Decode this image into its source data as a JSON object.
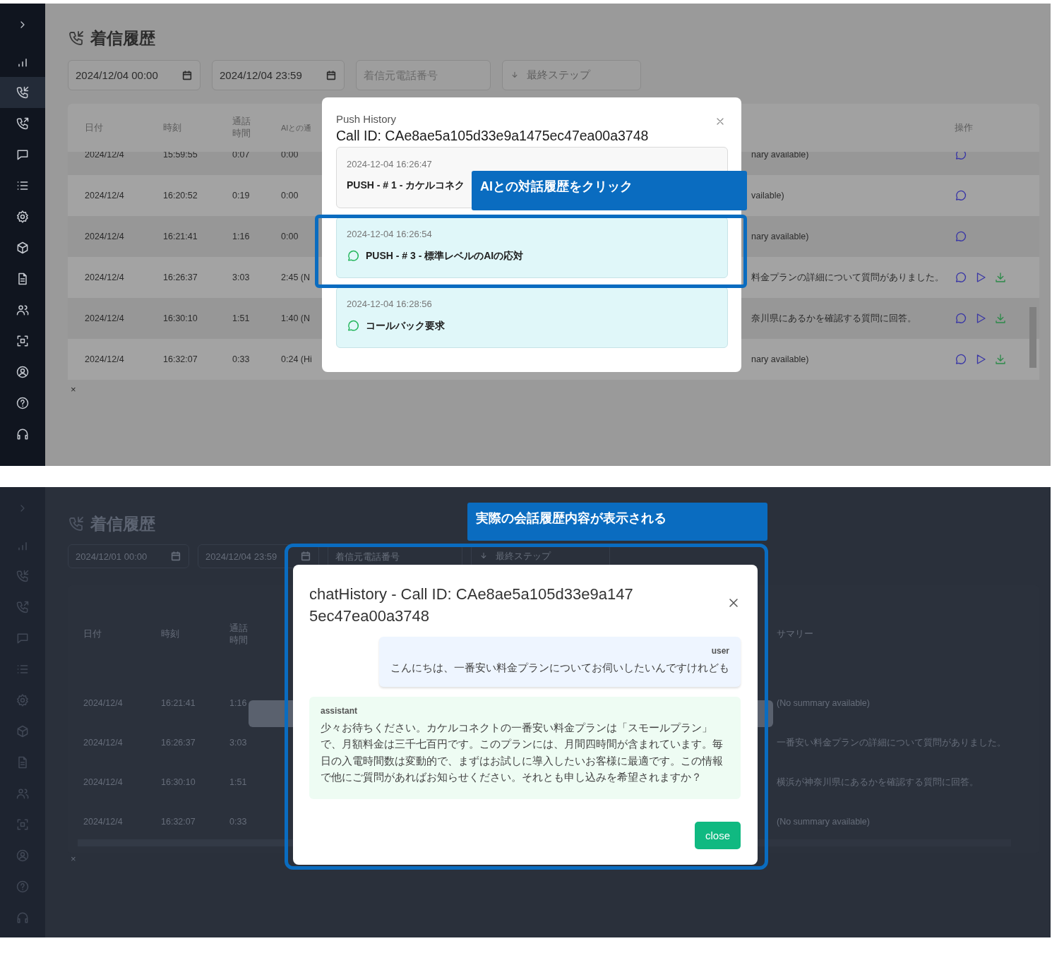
{
  "panels": [
    {
      "kind": "light",
      "sidebar": {
        "items": [
          {
            "selected": false
          },
          {
            "selected": true
          },
          {
            "selected": false
          },
          {
            "selected": false
          },
          {
            "selected": false
          },
          {
            "selected": false
          },
          {
            "selected": false
          },
          {
            "selected": false
          },
          {
            "selected": false
          },
          {
            "selected": false
          },
          {
            "selected": false
          },
          {
            "selected": false
          },
          {
            "selected": false
          }
        ]
      },
      "title": "着信履歴",
      "filters": [
        {
          "kind": "date",
          "value": "2024/12/04 00:00"
        },
        {
          "kind": "date",
          "value": "2024/12/04 23:59"
        },
        {
          "kind": "text",
          "placeholder": "着信元電話番号"
        },
        {
          "kind": "select",
          "label": "最終ステップ"
        }
      ],
      "table": {
        "columns": [
          {
            "kind": "date",
            "label": "日付"
          },
          {
            "kind": "time",
            "label": "時刻"
          },
          {
            "kind": "duration",
            "label": "通話時間"
          },
          {
            "kind": "ai",
            "label": "AIとの通"
          },
          {
            "kind": "actions",
            "label": "操作"
          }
        ],
        "rows": [
          {
            "cells": [
              {
                "kind": "date",
                "text": "2024/12/4"
              },
              {
                "kind": "time",
                "text": "15:59:55"
              },
              {
                "kind": "duration",
                "text": "0:07"
              },
              {
                "kind": "ai",
                "text": "0:00"
              },
              {
                "kind": "summary",
                "text": "nary available)"
              }
            ],
            "recording": false
          },
          {
            "cells": [
              {
                "kind": "date",
                "text": "2024/12/4"
              },
              {
                "kind": "time",
                "text": "16:20:52"
              },
              {
                "kind": "duration",
                "text": "0:19"
              },
              {
                "kind": "ai",
                "text": "0:00"
              },
              {
                "kind": "summary",
                "text": "vailable)"
              }
            ],
            "recording": false
          },
          {
            "cells": [
              {
                "kind": "date",
                "text": "2024/12/4"
              },
              {
                "kind": "time",
                "text": "16:21:41"
              },
              {
                "kind": "duration",
                "text": "1:16"
              },
              {
                "kind": "ai",
                "text": "0:00"
              },
              {
                "kind": "summary",
                "text": "nary available)"
              }
            ],
            "recording": false
          },
          {
            "cells": [
              {
                "kind": "date",
                "text": "2024/12/4"
              },
              {
                "kind": "time",
                "text": "16:26:37"
              },
              {
                "kind": "duration",
                "text": "3:03"
              },
              {
                "kind": "ai",
                "text": "2:45 (N"
              },
              {
                "kind": "summary",
                "text": "料金プランの詳細について質問がありました。"
              }
            ],
            "recording": true
          },
          {
            "cells": [
              {
                "kind": "date",
                "text": "2024/12/4"
              },
              {
                "kind": "time",
                "text": "16:30:10"
              },
              {
                "kind": "duration",
                "text": "1:51"
              },
              {
                "kind": "ai",
                "text": "1:40 (N"
              },
              {
                "kind": "summary",
                "text": "奈川県にあるかを確認する質問に回答。"
              }
            ],
            "recording": true
          },
          {
            "cells": [
              {
                "kind": "date",
                "text": "2024/12/4"
              },
              {
                "kind": "time",
                "text": "16:32:07"
              },
              {
                "kind": "duration",
                "text": "0:33"
              },
              {
                "kind": "ai",
                "text": "0:24 (Hi"
              },
              {
                "kind": "summary",
                "text": "nary available)"
              }
            ],
            "recording": true
          }
        ]
      },
      "dismiss": "×",
      "modal": {
        "kind": "push_history",
        "subtitle": "Push History",
        "title": "Call ID: CAe8ae5a105d33e9a1475ec47ea00a3748",
        "items": [
          {
            "kind": "plain",
            "time": "2024-12-04 16:26:47",
            "text": "PUSH - # 1 - カケルコネク"
          },
          {
            "kind": "chat",
            "time": "2024-12-04 16:26:54",
            "text": "PUSH - # 3 - 標準レベルのAIの応対"
          },
          {
            "kind": "chat",
            "time": "2024-12-04 16:28:56",
            "text": "コールバック要求"
          }
        ]
      },
      "annotations": [
        {
          "text": "AIとの対話履歴をクリック"
        }
      ]
    },
    {
      "kind": "dark",
      "sidebar": {
        "items": [
          {
            "selected": false
          },
          {
            "selected": false
          },
          {
            "selected": false
          },
          {
            "selected": false
          },
          {
            "selected": false
          },
          {
            "selected": false
          },
          {
            "selected": false
          },
          {
            "selected": false
          },
          {
            "selected": false
          },
          {
            "selected": false
          },
          {
            "selected": false
          },
          {
            "selected": false
          },
          {
            "selected": false
          }
        ]
      },
      "title": "着信履歴",
      "filters": [
        {
          "kind": "date",
          "value": "2024/12/01 00:00"
        },
        {
          "kind": "date",
          "value": "2024/12/04 23:59"
        },
        {
          "kind": "text",
          "placeholder": "着信元電話番号"
        },
        {
          "kind": "select",
          "label": "最終ステップ"
        }
      ],
      "table": {
        "columns": [
          {
            "kind": "date",
            "label": "日付"
          },
          {
            "kind": "time",
            "label": "時刻"
          },
          {
            "kind": "duration",
            "label": "通話時間"
          },
          {
            "kind": "summary",
            "label": "サマリー"
          }
        ],
        "rows": [
          {
            "cells": [
              {
                "kind": "date",
                "text": "2024/12/4"
              },
              {
                "kind": "time",
                "text": "16:21:41"
              },
              {
                "kind": "duration",
                "text": "1:16"
              },
              {
                "kind": "summary",
                "text": "(No summary available)"
              }
            ]
          },
          {
            "cells": [
              {
                "kind": "date",
                "text": "2024/12/4"
              },
              {
                "kind": "time",
                "text": "16:26:37"
              },
              {
                "kind": "duration",
                "text": "3:03"
              },
              {
                "kind": "summary",
                "text": "一番安い料金プランの詳細について質問がありました。"
              }
            ]
          },
          {
            "cells": [
              {
                "kind": "date",
                "text": "2024/12/4"
              },
              {
                "kind": "time",
                "text": "16:30:10"
              },
              {
                "kind": "duration",
                "text": "1:51"
              },
              {
                "kind": "summary",
                "text": "横浜が神奈川県にあるかを確認する質問に回答。"
              }
            ]
          },
          {
            "cells": [
              {
                "kind": "date",
                "text": "2024/12/4"
              },
              {
                "kind": "time",
                "text": "16:32:07"
              },
              {
                "kind": "duration",
                "text": "0:33"
              },
              {
                "kind": "summary",
                "text": "(No summary available)"
              }
            ]
          }
        ]
      },
      "dismiss": "×",
      "dimmed_popup": true,
      "modal": {
        "kind": "chat_history",
        "title": "chatHistory - Call ID: CAe8ae5a105d33e9a1475ec47ea00a3748",
        "messages": [
          {
            "kind": "user",
            "role": "user",
            "text": "こんにちは、一番安い料金プランについてお伺いしたいんですけれども"
          },
          {
            "kind": "assistant",
            "role": "assistant",
            "text": "少々お待ちください。カケルコネクトの一番安い料金プランは「スモールプラン」で、月額料金は三千七百円です。このプランには、月間四時間が含まれています。毎日の入電時間数は変動的で、まずはお試しに導入したいお客様に最適です。この情報で他にご質問があればお知らせください。それとも申し込みを希望されますか？"
          }
        ],
        "button": "close"
      },
      "annotations": [
        {
          "text": "実際の会話履歴内容が表示される"
        }
      ]
    }
  ]
}
